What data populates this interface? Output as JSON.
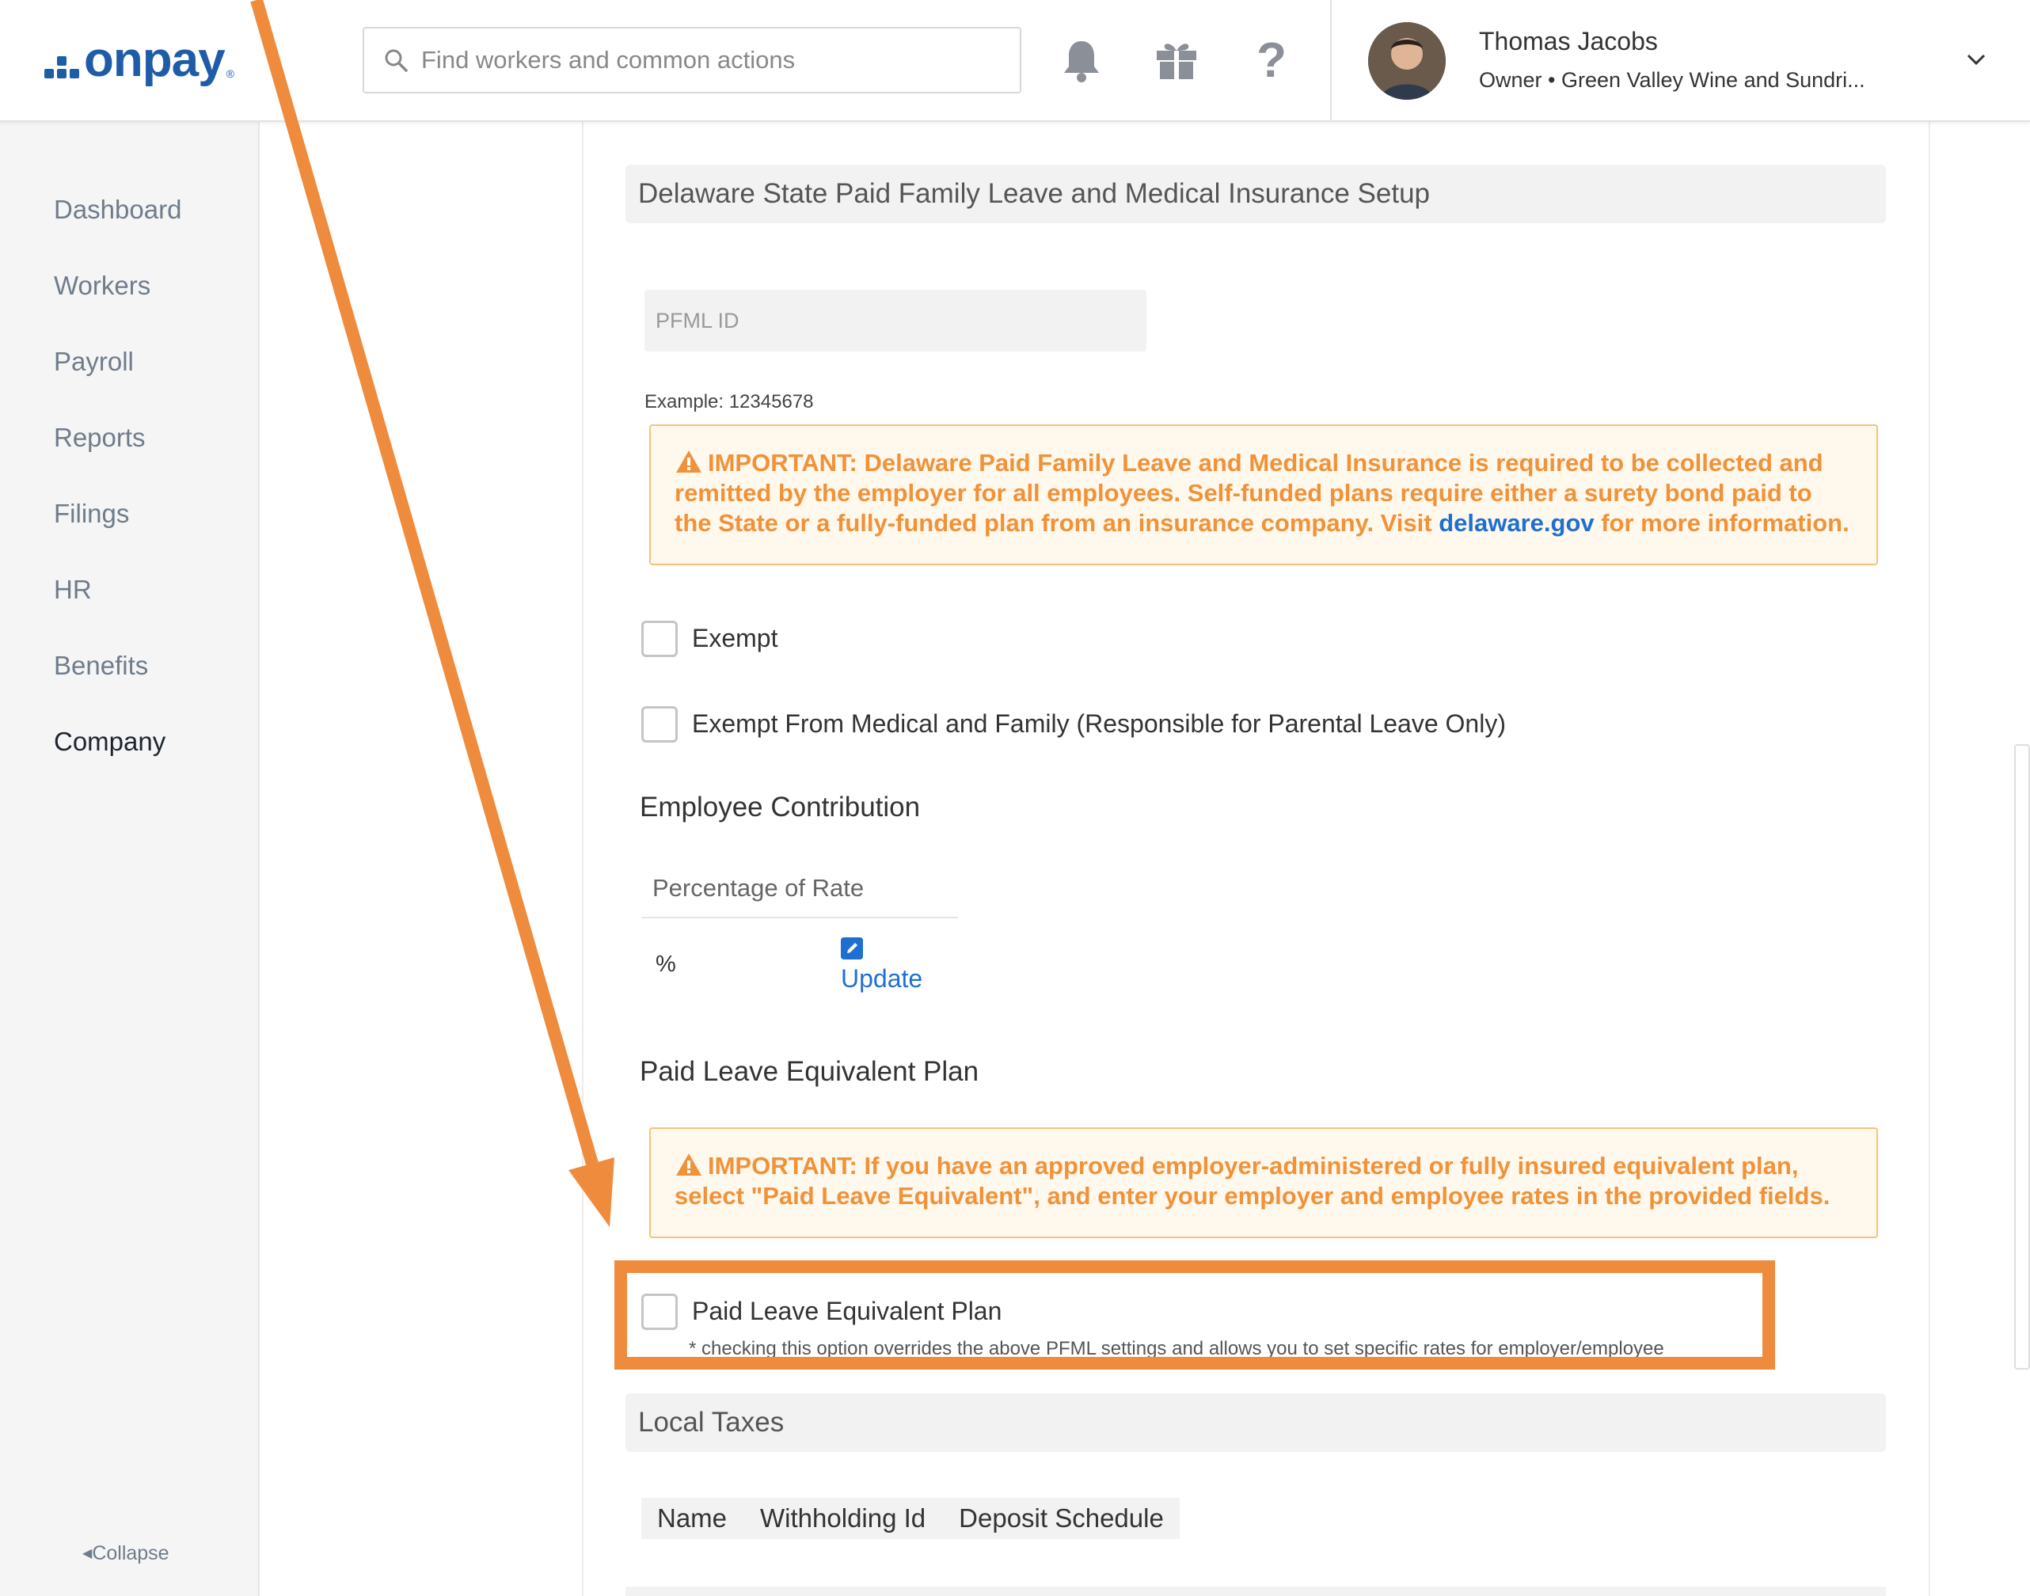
{
  "brand": {
    "logo_text": "onpay",
    "registered": "®",
    "accent_color": "#1f5ca8"
  },
  "header": {
    "search_placeholder": "Find workers and common actions",
    "help_glyph": "?",
    "icons": [
      "search-icon",
      "bell-icon",
      "gift-icon",
      "help-icon",
      "chevron-down-icon"
    ],
    "user": {
      "name": "Thomas Jacobs",
      "role": "Owner • Green Valley Wine and Sundri..."
    }
  },
  "sidebar": {
    "items": [
      {
        "label": "Dashboard"
      },
      {
        "label": "Workers"
      },
      {
        "label": "Payroll"
      },
      {
        "label": "Reports"
      },
      {
        "label": "Filings"
      },
      {
        "label": "HR"
      },
      {
        "label": "Benefits"
      },
      {
        "label": "Company",
        "active": true
      }
    ],
    "collapse_label": "Collapse"
  },
  "main": {
    "section_title": "Delaware State Paid Family Leave and Medical Insurance Setup",
    "pfml_placeholder": "PFML ID",
    "pfml_example": "Example: 12345678",
    "warning1": {
      "before_link": "IMPORTANT: Delaware Paid Family Leave and Medical Insurance is required to be collected and remitted by the employer for all employees. Self-funded plans require either a surety bond paid to the State or a fully-funded plan from an insurance company. Visit ",
      "link": "delaware.gov",
      "after_link": " for more information."
    },
    "checkbox_exempt": "Exempt",
    "checkbox_exempt_medical": "Exempt From Medical and Family (Responsible for Parental Leave Only)",
    "employee_contribution_title": "Employee Contribution",
    "percentage_header": "Percentage of Rate",
    "percentage_value": "%",
    "update_link": "Update",
    "paid_leave_title": "Paid Leave Equivalent Plan",
    "warning2": "IMPORTANT: If you have an approved employer-administered or fully insured equivalent plan, select \"Paid Leave Equivalent\", and enter your employer and employee rates in the provided fields.",
    "checkbox_paid_leave": "Paid Leave Equivalent Plan",
    "paid_leave_note": "* checking this option overrides the above PFML settings and allows you to set specific rates for employer/employee",
    "local_taxes_title": "Local Taxes",
    "local_taxes_columns": [
      "Name",
      "Withholding Id",
      "Deposit Schedule"
    ]
  },
  "annotation": {
    "color": "#ef8b3c"
  }
}
